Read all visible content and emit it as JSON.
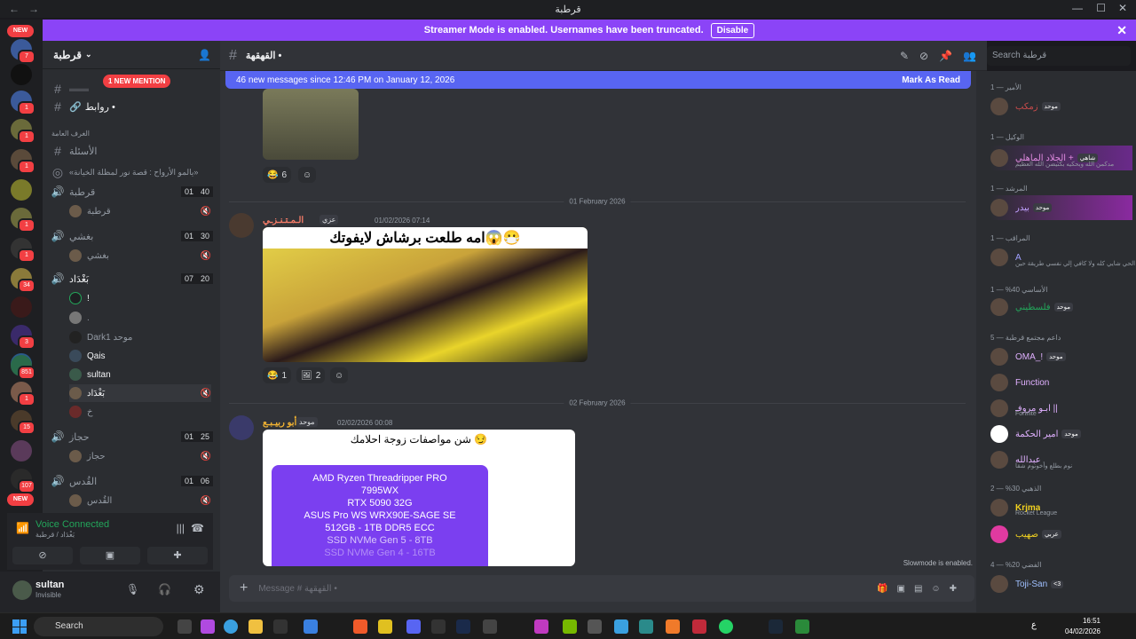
{
  "window": {
    "title": "قرطبة",
    "nav_back": "←",
    "nav_fwd": "→"
  },
  "banner": {
    "text": "Streamer Mode is enabled. Usernames have been truncated.",
    "button": "Disable",
    "close": "✕"
  },
  "rail": {
    "new_top": "NEW",
    "new_bottom": "NEW",
    "badges": [
      "7",
      "1",
      "1",
      "1",
      "1",
      "1",
      "34",
      "3",
      "1",
      "851",
      "1",
      "15",
      "107"
    ]
  },
  "guild": {
    "name": "قرطبة"
  },
  "sidebar": {
    "mention": "1 NEW MENTION",
    "channels_top": [
      {
        "name": "روابط •"
      }
    ],
    "category": "الغرف العامة",
    "text_channels": [
      {
        "name": "الأسئلة"
      },
      {
        "name": "«يالمو الأرواح : قصة نور لمظلة الخيانة»"
      }
    ],
    "voice": [
      {
        "name": "قرطبة",
        "a": "01",
        "b": "40",
        "users": [
          "قرطبة"
        ]
      },
      {
        "name": "بغشي",
        "a": "01",
        "b": "30",
        "users": [
          "بغشي"
        ]
      },
      {
        "name": "بَغْدَاد",
        "a": "07",
        "b": "20",
        "users": [
          "!",
          ".",
          "Dark1 موحد",
          "Qais",
          "sultan",
          "بَغْدَاد",
          "خ"
        ]
      },
      {
        "name": "حجاز",
        "a": "01",
        "b": "25",
        "users": [
          "حجاز"
        ]
      },
      {
        "name": "القُدس",
        "a": "01",
        "b": "06",
        "users": [
          "القُدس"
        ]
      }
    ]
  },
  "voice_panel": {
    "status": "Voice Connected",
    "channel": "بَغْدَاد / قرطبة"
  },
  "user_panel": {
    "name": "sultan",
    "status": "Invisible"
  },
  "channel_header": {
    "name": "القهقهة •"
  },
  "search": {
    "placeholder": "Search قرطبة"
  },
  "main": {
    "new_messages": "46 new messages since 12:46 PM on January 12, 2026",
    "mark_as_read": "Mark As Read",
    "reaction_top": "6",
    "date1": "01 February 2026",
    "msg1": {
      "user": "الـمـتـنـزـي",
      "tag": "عزي",
      "time": "01/02/2026 07:14",
      "caption": "امه طلعت برشاش لايفوتك😱😷"
    },
    "msg1_reacts": [
      "1",
      "2"
    ],
    "date2": "02 February 2026",
    "msg2": {
      "user": "أبو ربيـبـع",
      "tag": "موحد",
      "time": "02/02/2026 00:08",
      "caption": "شن مواصفات زوجة احلامك 😏",
      "specs": [
        "AMD Ryzen Threadripper PRO",
        "7995WX",
        "RTX 5090 32G",
        "ASUS Pro WS WRX90E-SAGE SE",
        "512GB - 1TB DDR5 ECC",
        "SSD NVMe Gen 5 - 8TB",
        "SSD NVMe Gen 4 - 16TB"
      ]
    },
    "slowmode": "Slowmode is enabled.",
    "composer_placeholder": "Message # القهقهة •"
  },
  "members": {
    "categories": [
      "الأمير — 1",
      "الوكيل — 1",
      "المرشد — 1",
      "المراقب — 1",
      "الأساسي 40% — 1",
      "داعم مجتمع قرطبة — 5",
      "الذهبي 30% — 2",
      "الفضي 20% — 4"
    ],
    "list": [
      {
        "name": "زمكب",
        "tag": "موحد",
        "status": ""
      },
      {
        "name": "الجلاد الماهلي +",
        "tag": "شاهي",
        "status": "مدكمن الله وبحكيه بكتيضن الله العظيم"
      },
      {
        "name": "بيدر",
        "tag": "موحد",
        "status": ""
      },
      {
        "name": "A",
        "tag": "",
        "status": "الحي شايي كله ولا كافي إلي نفسي طريقة حين"
      },
      {
        "name": "فلسطيني",
        "tag": "موحد",
        "status": ""
      },
      {
        "name": "OMA_!",
        "tag": "موحد",
        "status": ""
      },
      {
        "name": "Function",
        "tag": "",
        "status": ""
      },
      {
        "name": "ابـو مروفـ ||",
        "tag": "",
        "status": "Fortnite"
      },
      {
        "name": "أمير الحكمة",
        "tag": "موحد",
        "status": ""
      },
      {
        "name": "عبدالله",
        "tag": "",
        "status": "نوم بطلع وأخونوم شقا"
      },
      {
        "name": "Krjma",
        "tag": "",
        "status": "Rocket League"
      },
      {
        "name": "صهيب",
        "tag": "عربي",
        "status": ""
      },
      {
        "name": "Toji-San",
        "tag": "<3",
        "status": ""
      }
    ]
  },
  "taskbar": {
    "search": "Search",
    "time": "16:51",
    "date": "04/02/2026",
    "lang": "ع"
  },
  "colors": {
    "accent": "#5865f2",
    "banner": "#8b44f7",
    "online": "#23a55a",
    "alert": "#f23f43"
  }
}
